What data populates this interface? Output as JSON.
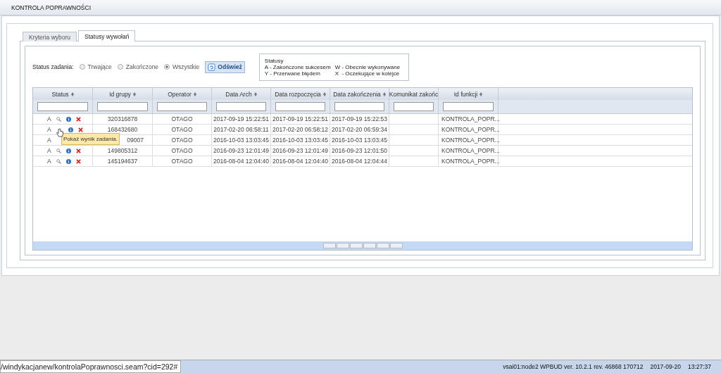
{
  "header": {
    "title": "KONTROLA POPRAWNOŚCI"
  },
  "tabs": [
    {
      "label": "Kryteria wyboru",
      "selected": false
    },
    {
      "label": "Statusy wywołań",
      "selected": true
    }
  ],
  "filter": {
    "label": "Status zadania:",
    "options": [
      {
        "label": "Trwające",
        "selected": false
      },
      {
        "label": "Zakończone",
        "selected": false
      },
      {
        "label": "Wszystkie",
        "selected": true
      }
    ],
    "button": "Odśwież"
  },
  "legend": {
    "title": "Statusy",
    "items": [
      "A - Zakończone sukcesem",
      "W - Obecnie wykonywane",
      "Y - Przerwane błędem",
      "X  - Oczekujące w kolejce"
    ]
  },
  "table": {
    "columns": [
      "Status",
      "Id grupy",
      "Operator",
      "Data Arch",
      "Data rozpoczęcia",
      "Data zakończenia",
      "Komunikat zakońc",
      "Id funkcji"
    ],
    "rows": [
      {
        "actions": [
          {
            "kind": "search"
          },
          {
            "kind": "info"
          },
          {
            "kind": "delete"
          }
        ],
        "cells": [
          "A",
          "320316878",
          "OTAGO",
          "2017-09-19 15:22:51",
          "2017-09-19 15:22:51",
          "2017-09-19 15:22:53",
          "",
          "KONTROLA_POPR..."
        ]
      },
      {
        "actions": [
          {
            "kind": "cursor"
          },
          {
            "kind": "info"
          },
          {
            "kind": "delete"
          }
        ],
        "cells": [
          "A",
          "168432680",
          "OTAGO",
          "2017-02-20 06:58:11",
          "2017-02-20 06:58:12",
          "2017-02-20 06:59:34",
          "",
          "KONTROLA_POPR..."
        ]
      },
      {
        "cells": [
          "A",
          "09007",
          "OTAGO",
          "2016-10-03 13:03:45",
          "2016-10-03 13:03:45",
          "2016-10-03 13:03:45",
          "",
          "KONTROLA_POPR..."
        ]
      },
      {
        "actions": [
          {
            "kind": "search"
          },
          {
            "kind": "info"
          },
          {
            "kind": "delete"
          }
        ],
        "cells": [
          "A",
          "149805312",
          "OTAGO",
          "2016-09-23 12:01:49",
          "2016-09-23 12:01:49",
          "2016-09-23 12:01:50",
          "",
          "KONTROLA_POPR..."
        ]
      },
      {
        "actions": [
          {
            "kind": "search"
          },
          {
            "kind": "info"
          },
          {
            "kind": "delete"
          }
        ],
        "cells": [
          "A",
          "145194637",
          "OTAGO",
          "2016-08-04 12:04:40",
          "2016-08-04 12:04:40",
          "2016-08-04 12:04:44",
          "",
          "KONTROLA_POPR..."
        ]
      }
    ]
  },
  "tooltip": "Pokaż wynik zadania.",
  "status_bar": {
    "url": "/windykacjanew/kontrolaPoprawnosci.seam?cid=292#",
    "version": "vsai01:node2 WPBUD ver. 10.2.1 rev. 46868 170712",
    "date": "2017-09-20",
    "time": "13:27:37"
  }
}
